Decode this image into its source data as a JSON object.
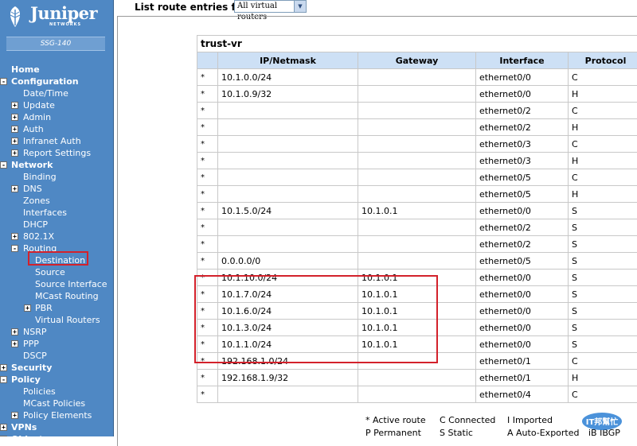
{
  "logo": {
    "brand": "Juniper",
    "sub": "NETWORKS"
  },
  "device": "SSG-140",
  "nav": [
    {
      "id": "home",
      "label": "Home",
      "indent": 1,
      "bold": true,
      "toggle": "",
      "active": false
    },
    {
      "id": "configuration",
      "label": "Configuration",
      "indent": 1,
      "bold": true,
      "toggle": "-",
      "active": false
    },
    {
      "id": "date-time",
      "label": "Date/Time",
      "indent": 2,
      "bold": false,
      "toggle": "",
      "active": false
    },
    {
      "id": "update",
      "label": "Update",
      "indent": 2,
      "bold": false,
      "toggle": "+",
      "active": false
    },
    {
      "id": "admin",
      "label": "Admin",
      "indent": 2,
      "bold": false,
      "toggle": "+",
      "active": false
    },
    {
      "id": "auth",
      "label": "Auth",
      "indent": 2,
      "bold": false,
      "toggle": "+",
      "active": false
    },
    {
      "id": "infranet-auth",
      "label": "Infranet Auth",
      "indent": 2,
      "bold": false,
      "toggle": "+",
      "active": false
    },
    {
      "id": "report-settings",
      "label": "Report Settings",
      "indent": 2,
      "bold": false,
      "toggle": "+",
      "active": false
    },
    {
      "id": "network",
      "label": "Network",
      "indent": 1,
      "bold": true,
      "toggle": "-",
      "active": false
    },
    {
      "id": "binding",
      "label": "Binding",
      "indent": 2,
      "bold": false,
      "toggle": "",
      "active": false
    },
    {
      "id": "dns",
      "label": "DNS",
      "indent": 2,
      "bold": false,
      "toggle": "+",
      "active": false
    },
    {
      "id": "zones",
      "label": "Zones",
      "indent": 2,
      "bold": false,
      "toggle": "",
      "active": false
    },
    {
      "id": "interfaces",
      "label": "Interfaces",
      "indent": 2,
      "bold": false,
      "toggle": "",
      "active": false
    },
    {
      "id": "dhcp",
      "label": "DHCP",
      "indent": 2,
      "bold": false,
      "toggle": "",
      "active": false
    },
    {
      "id": "8021x",
      "label": "802.1X",
      "indent": 2,
      "bold": false,
      "toggle": "+",
      "active": false
    },
    {
      "id": "routing",
      "label": "Routing",
      "indent": 2,
      "bold": false,
      "toggle": "-",
      "active": false
    },
    {
      "id": "destination",
      "label": "Destination",
      "indent": 3,
      "bold": false,
      "toggle": "",
      "active": true
    },
    {
      "id": "source",
      "label": "Source",
      "indent": 3,
      "bold": false,
      "toggle": "",
      "active": false
    },
    {
      "id": "source-interface",
      "label": "Source Interface",
      "indent": 3,
      "bold": false,
      "toggle": "",
      "active": false
    },
    {
      "id": "mcast-routing",
      "label": "MCast Routing",
      "indent": 3,
      "bold": false,
      "toggle": "",
      "active": false
    },
    {
      "id": "pbr",
      "label": "PBR",
      "indent": 3,
      "bold": false,
      "toggle": "+",
      "active": false
    },
    {
      "id": "virtual-routers",
      "label": "Virtual Routers",
      "indent": 3,
      "bold": false,
      "toggle": "",
      "active": false
    },
    {
      "id": "nsrp",
      "label": "NSRP",
      "indent": 2,
      "bold": false,
      "toggle": "+",
      "active": false
    },
    {
      "id": "ppp",
      "label": "PPP",
      "indent": 2,
      "bold": false,
      "toggle": "+",
      "active": false
    },
    {
      "id": "dscp",
      "label": "DSCP",
      "indent": 2,
      "bold": false,
      "toggle": "",
      "active": false
    },
    {
      "id": "security",
      "label": "Security",
      "indent": 1,
      "bold": true,
      "toggle": "+",
      "active": false
    },
    {
      "id": "policy",
      "label": "Policy",
      "indent": 1,
      "bold": true,
      "toggle": "-",
      "active": false
    },
    {
      "id": "policies",
      "label": "Policies",
      "indent": 2,
      "bold": false,
      "toggle": "",
      "active": false
    },
    {
      "id": "mcast-policies",
      "label": "MCast Policies",
      "indent": 2,
      "bold": false,
      "toggle": "",
      "active": false
    },
    {
      "id": "policy-elements",
      "label": "Policy Elements",
      "indent": 2,
      "bold": false,
      "toggle": "+",
      "active": false
    },
    {
      "id": "vpns",
      "label": "VPNs",
      "indent": 1,
      "bold": true,
      "toggle": "+",
      "active": false
    },
    {
      "id": "objects",
      "label": "Objects",
      "indent": 1,
      "bold": true,
      "toggle": "+",
      "active": false
    }
  ],
  "header": {
    "label": "List route entries for",
    "select_value": "All virtual routers"
  },
  "table": {
    "title": "trust-vr",
    "columns": [
      "",
      "IP/Netmask",
      "Gateway",
      "Interface",
      "Protocol"
    ],
    "rows": [
      [
        "*",
        "10.1.0.0/24",
        "",
        "ethernet0/0",
        "C"
      ],
      [
        "*",
        "10.1.0.9/32",
        "",
        "ethernet0/0",
        "H"
      ],
      [
        "*",
        "",
        "",
        "ethernet0/2",
        "C"
      ],
      [
        "*",
        "",
        "",
        "ethernet0/2",
        "H"
      ],
      [
        "*",
        "",
        "",
        "ethernet0/3",
        "C"
      ],
      [
        "*",
        "",
        "",
        "ethernet0/3",
        "H"
      ],
      [
        "*",
        "",
        "",
        "ethernet0/5",
        "C"
      ],
      [
        "*",
        "",
        "",
        "ethernet0/5",
        "H"
      ],
      [
        "*",
        "10.1.5.0/24",
        "10.1.0.1",
        "ethernet0/0",
        "S"
      ],
      [
        "*",
        "",
        "",
        "ethernet0/2",
        "S"
      ],
      [
        "*",
        "",
        "",
        "ethernet0/2",
        "S"
      ],
      [
        "*",
        "0.0.0.0/0",
        "",
        "ethernet0/5",
        "S"
      ],
      [
        "*",
        "10.1.10.0/24",
        "10.1.0.1",
        "ethernet0/0",
        "S"
      ],
      [
        "*",
        "10.1.7.0/24",
        "10.1.0.1",
        "ethernet0/0",
        "S"
      ],
      [
        "*",
        "10.1.6.0/24",
        "10.1.0.1",
        "ethernet0/0",
        "S"
      ],
      [
        "*",
        "10.1.3.0/24",
        "10.1.0.1",
        "ethernet0/0",
        "S"
      ],
      [
        "*",
        "10.1.1.0/24",
        "10.1.0.1",
        "ethernet0/0",
        "S"
      ],
      [
        "*",
        "192.168.1.0/24",
        "",
        "ethernet0/1",
        "C"
      ],
      [
        "*",
        "192.168.1.9/32",
        "",
        "ethernet0/1",
        "H"
      ],
      [
        "*",
        "",
        "",
        "ethernet0/4",
        "C"
      ]
    ]
  },
  "legend": {
    "active": "* Active route",
    "permanent": "P Permanent",
    "connected": "C Connected",
    "static": "S Static",
    "imported": "I  Imported",
    "auto_exported": "A Auto-Exported",
    "ibgp": "iB  IBGP"
  },
  "watermark": "IT邦幫忙",
  "colors": {
    "sidebar_bg": "#4f88c4",
    "table_header_bg": "#cde0f5",
    "highlight_red": "#d3212b"
  }
}
